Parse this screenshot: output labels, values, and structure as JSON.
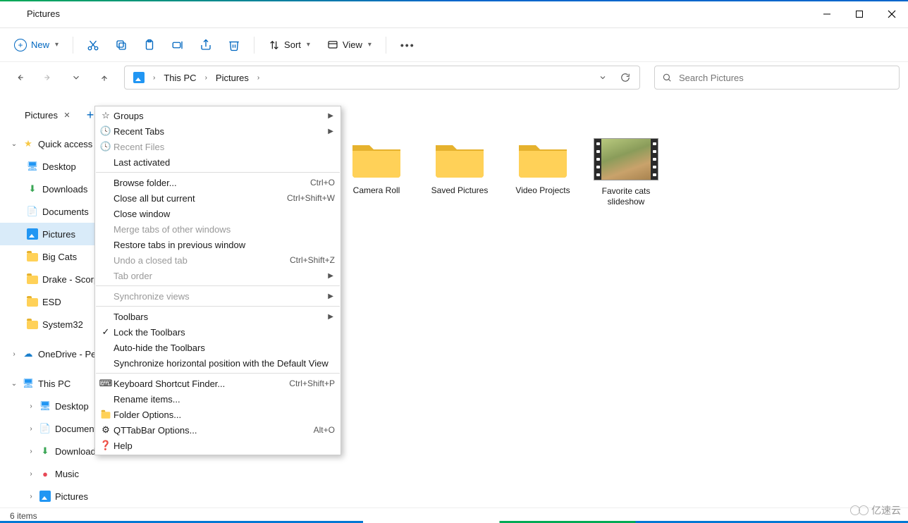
{
  "window": {
    "title": "Pictures"
  },
  "toolbar": {
    "new": "New",
    "sort": "Sort",
    "view": "View"
  },
  "breadcrumb": {
    "root": "This PC",
    "current": "Pictures"
  },
  "search": {
    "placeholder": "Search Pictures"
  },
  "tab": {
    "label": "Pictures"
  },
  "sidebar": {
    "quick_access": "Quick access",
    "desktop": "Desktop",
    "downloads": "Downloads",
    "documents": "Documents",
    "pictures": "Pictures",
    "big_cats": "Big Cats",
    "drake": "Drake - Scorpion",
    "esd": "ESD",
    "system32": "System32",
    "onedrive": "OneDrive - Personal",
    "this_pc": "This PC",
    "tp_desktop": "Desktop",
    "tp_documents": "Documents",
    "tp_downloads": "Downloads",
    "tp_music": "Music",
    "tp_pictures": "Pictures"
  },
  "items": {
    "camera_roll": "Camera Roll",
    "saved_pictures": "Saved Pictures",
    "video_projects": "Video Projects",
    "favorite_cats": "Favorite cats slideshow"
  },
  "menu": {
    "groups": "Groups",
    "recent_tabs": "Recent Tabs",
    "recent_files": "Recent Files",
    "last_activated": "Last activated",
    "browse_folder": "Browse folder...",
    "browse_folder_sc": "Ctrl+O",
    "close_all_but": "Close all but current",
    "close_all_but_sc": "Ctrl+Shift+W",
    "close_window": "Close window",
    "merge_tabs": "Merge tabs of other windows",
    "restore_tabs": "Restore tabs in previous window",
    "undo_closed": "Undo a closed tab",
    "undo_closed_sc": "Ctrl+Shift+Z",
    "tab_order": "Tab order",
    "sync_views": "Synchronize views",
    "toolbars": "Toolbars",
    "lock_toolbars": "Lock the Toolbars",
    "autohide_toolbars": "Auto-hide the Toolbars",
    "sync_horiz": "Synchronize horizontal position with the Default View",
    "keyboard_sc_finder": "Keyboard Shortcut Finder...",
    "keyboard_sc_finder_sc": "Ctrl+Shift+P",
    "rename_items": "Rename items...",
    "folder_options": "Folder Options...",
    "qttabbar_options": "QTTabBar Options...",
    "qttabbar_options_sc": "Alt+O",
    "help": "Help"
  },
  "status": {
    "text": "6 items"
  },
  "watermark": "亿速云"
}
